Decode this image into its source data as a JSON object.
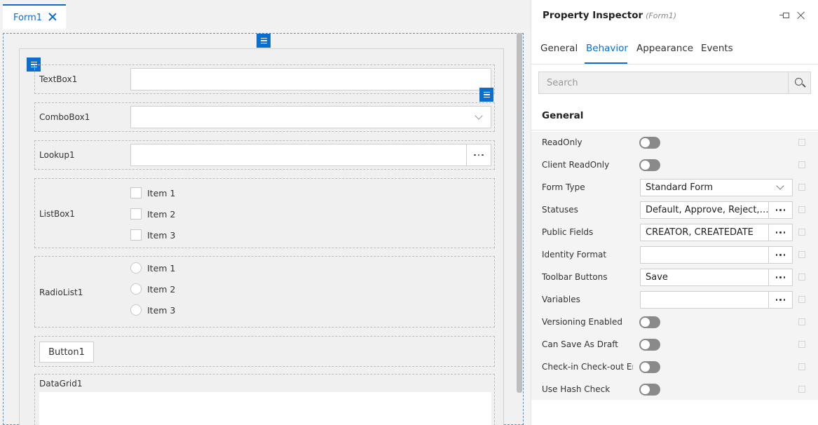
{
  "designer": {
    "tab_label": "Form1",
    "fields": {
      "textbox_label": "TextBox1",
      "combobox_label": "ComboBox1",
      "lookup_label": "Lookup1",
      "listbox_label": "ListBox1",
      "listbox_items": [
        "Item 1",
        "Item 2",
        "Item 3"
      ],
      "radiolist_label": "RadioList1",
      "radiolist_items": [
        "Item 1",
        "Item 2",
        "Item 3"
      ],
      "button_label": "Button1",
      "datagrid_label": "DataGrid1"
    }
  },
  "inspector": {
    "title": "Property Inspector",
    "subtitle": "(Form1)",
    "tabs": [
      {
        "label": "General",
        "active": false
      },
      {
        "label": "Behavior",
        "active": true
      },
      {
        "label": "Appearance",
        "active": false
      },
      {
        "label": "Events",
        "active": false
      }
    ],
    "search_placeholder": "Search",
    "section_title": "General",
    "properties": [
      {
        "label": "ReadOnly",
        "kind": "toggle",
        "value": "off"
      },
      {
        "label": "Client ReadOnly",
        "kind": "toggle",
        "value": "off"
      },
      {
        "label": "Form Type",
        "kind": "select",
        "value": "Standard Form"
      },
      {
        "label": "Statuses",
        "kind": "picker",
        "value": "Default, Approve, Reject, ..."
      },
      {
        "label": "Public Fields",
        "kind": "picker",
        "value": "CREATOR, CREATEDATE"
      },
      {
        "label": "Identity Format",
        "kind": "picker",
        "value": ""
      },
      {
        "label": "Toolbar Buttons",
        "kind": "picker",
        "value": "Save"
      },
      {
        "label": "Variables",
        "kind": "picker",
        "value": ""
      },
      {
        "label": "Versioning Enabled",
        "kind": "toggle",
        "value": "off"
      },
      {
        "label": "Can Save As Draft",
        "kind": "toggle",
        "value": "off"
      },
      {
        "label": "Check-in Check-out En...",
        "kind": "toggle",
        "value": "off"
      },
      {
        "label": "Use Hash Check",
        "kind": "toggle",
        "value": "off"
      }
    ]
  },
  "colors": {
    "accent": "#0a6ed1",
    "toggle_off": "#8a8a8a"
  }
}
